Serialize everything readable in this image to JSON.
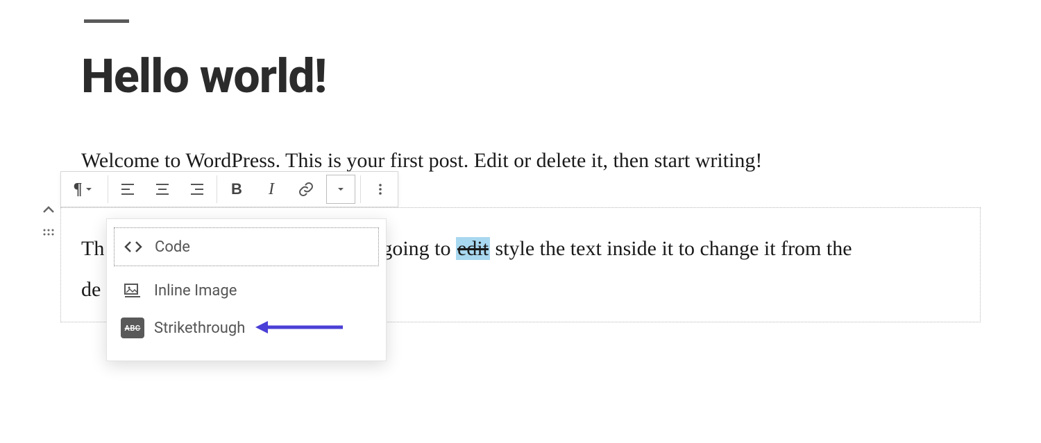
{
  "title": "Hello world!",
  "paragraph1": "Welcome to WordPress. This is your first post. Edit or delete it, then start writing!",
  "paragraph2": {
    "prefix_hidden": "Th",
    "mid_text": "going to ",
    "highlighted": "edit",
    "rest": " style the text inside it to change it from the",
    "line2_prefix": "de"
  },
  "toolbar": {
    "paragraph_btn": "¶",
    "bold": "B",
    "italic": "I"
  },
  "dropdown": {
    "code": "Code",
    "inline_image": "Inline Image",
    "strikethrough": "Strikethrough",
    "abc": "ABC"
  }
}
